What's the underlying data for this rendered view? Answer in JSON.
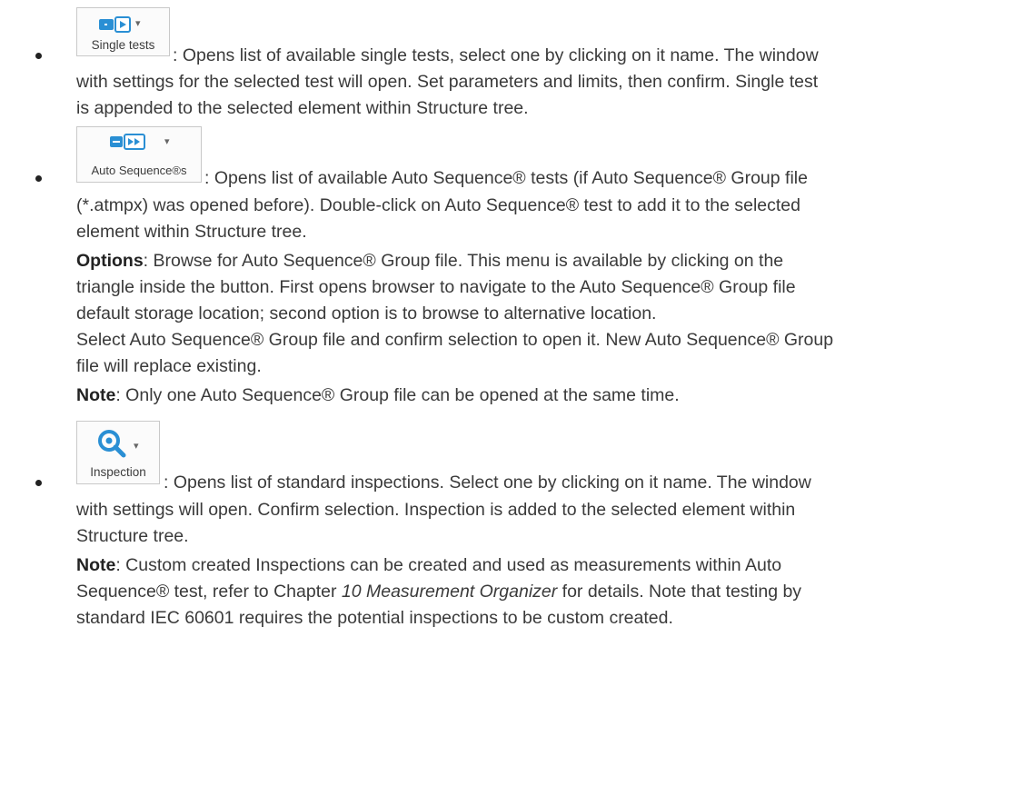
{
  "items": [
    {
      "button_label": "Single tests",
      "lines": [
        ": Opens list of available single tests, select one by clicking on it name. The window",
        "with settings for the selected test will open. Set parameters and limits, then confirm. Single test",
        "is appended to the selected element within Structure tree."
      ]
    },
    {
      "button_label": "Auto Sequence®s",
      "lines": [
        ": Opens list of available Auto Sequence® tests (if Auto Sequence® Group file",
        "(*.atmpx) was opened before). Double-click on Auto Sequence® test to add it to the selected",
        "element within Structure tree."
      ],
      "options_label": "Options",
      "options_lines": [
        ": Browse for Auto Sequence® Group file. This menu is available by clicking on the",
        "triangle inside the button. First opens browser to navigate to the Auto Sequence® Group file",
        "default storage location; second option is to browse to alternative location.",
        "Select Auto Sequence® Group file and confirm selection to open it. New Auto Sequence® Group",
        "file will replace existing."
      ],
      "note_label": "Note",
      "note_text": ": Only one Auto Sequence® Group file can be opened at the same time."
    },
    {
      "button_label": "Inspection",
      "lines": [
        ": Opens list of standard inspections. Select one by clicking on it name. The window",
        "with settings will open. Confirm selection. Inspection is added to the selected element within",
        "Structure tree."
      ],
      "note_label": "Note",
      "note_line1": ": Custom created Inspections can be created and used as measurements within Auto",
      "note_line2_pre": "Sequence® test, refer to Chapter ",
      "note_chapter": "10 Measurement Organizer",
      "note_line2_post": " for details. Note that testing by",
      "note_line3": "standard IEC 60601 requires the potential inspections to be custom created."
    }
  ],
  "icons": [
    "play-single-icon",
    "play-double-icon",
    "magnifier-eye-icon",
    "dropdown-arrow-icon"
  ],
  "colors": {
    "icon_blue": "#2a8fd4",
    "text": "#3a3a3a",
    "border": "#c9c9c9"
  }
}
